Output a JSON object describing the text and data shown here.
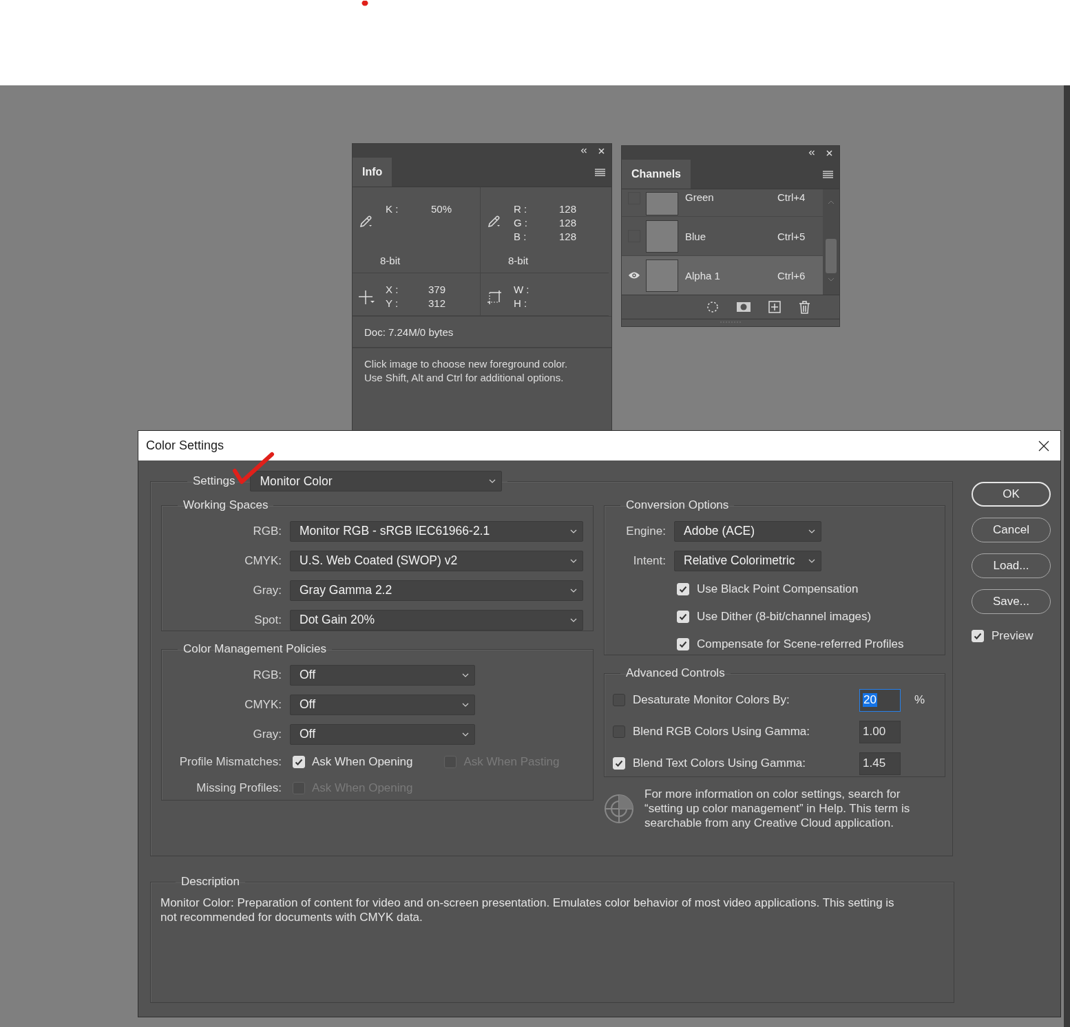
{
  "info_panel": {
    "tab": "Info",
    "color_readouts": [
      {
        "lines": [
          {
            "label": "K :",
            "value": "50%"
          }
        ],
        "bit_depth": "8-bit"
      },
      {
        "lines": [
          {
            "label": "R :",
            "value": "128"
          },
          {
            "label": "G :",
            "value": "128"
          },
          {
            "label": "B :",
            "value": "128"
          }
        ],
        "bit_depth": "8-bit"
      }
    ],
    "geometry_readouts": [
      {
        "kind": "point",
        "lines": [
          {
            "label": "X :",
            "value": "379"
          },
          {
            "label": "Y :",
            "value": "312"
          }
        ]
      },
      {
        "kind": "size",
        "lines": [
          {
            "label": "W :"
          },
          {
            "label": "H :"
          }
        ]
      }
    ],
    "doc": "Doc: 7.24M/0 bytes",
    "hint_lines": [
      "Click image to choose new foreground color.",
      "Use Shift, Alt and Ctrl for additional options."
    ]
  },
  "channels_panel": {
    "tab": "Channels",
    "channels": [
      {
        "name": "Green",
        "shortcut": "Ctrl+4",
        "visible": false,
        "selected": false
      },
      {
        "name": "Blue",
        "shortcut": "Ctrl+5",
        "visible": false,
        "selected": false
      },
      {
        "name": "Alpha 1",
        "shortcut": "Ctrl+6",
        "visible": true,
        "selected": true
      }
    ]
  },
  "dialog": {
    "title": "Color Settings",
    "settings": {
      "label": "Settings",
      "value": "Monitor Color"
    },
    "working_spaces": {
      "title": "Working Spaces",
      "rows": [
        {
          "label": "RGB:",
          "value": "Monitor RGB - sRGB IEC61966-2.1"
        },
        {
          "label": "CMYK:",
          "value": "U.S. Web Coated (SWOP) v2"
        },
        {
          "label": "Gray:",
          "value": "Gray Gamma 2.2"
        },
        {
          "label": "Spot:",
          "value": "Dot Gain 20%"
        }
      ]
    },
    "policies": {
      "title": "Color Management Policies",
      "rows": [
        {
          "label": "RGB:",
          "value": "Off"
        },
        {
          "label": "CMYK:",
          "value": "Off"
        },
        {
          "label": "Gray:",
          "value": "Off"
        }
      ],
      "checks": [
        {
          "label": "Profile Mismatches:",
          "options": [
            {
              "label": "Ask When Opening",
              "checked": true,
              "disabled": false
            },
            {
              "label": "Ask When Pasting",
              "checked": false,
              "disabled": true
            }
          ]
        },
        {
          "label": "Missing Profiles:",
          "options": [
            {
              "label": "Ask When Opening",
              "checked": false,
              "disabled": true
            }
          ]
        }
      ]
    },
    "conversion": {
      "title": "Conversion Options",
      "selects": [
        {
          "label": "Engine:",
          "value": "Adobe (ACE)"
        },
        {
          "label": "Intent:",
          "value": "Relative Colorimetric"
        }
      ],
      "options": [
        {
          "label": "Use Black Point Compensation",
          "checked": true
        },
        {
          "label": "Use Dither (8-bit/channel images)",
          "checked": true
        },
        {
          "label": "Compensate for Scene-referred Profiles",
          "checked": true
        }
      ]
    },
    "advanced": {
      "title": "Advanced Controls",
      "rows": [
        {
          "label": "Desaturate Monitor Colors By:",
          "checked": false,
          "value": "20",
          "value_selected": true,
          "unit": "%"
        },
        {
          "label": "Blend RGB Colors Using Gamma:",
          "checked": false,
          "value": "1.00",
          "value_selected": false
        },
        {
          "label": "Blend Text Colors Using Gamma:",
          "checked": true,
          "value": "1.45",
          "value_selected": false
        }
      ]
    },
    "help_text": "For more information on color settings, search for “setting up color management” in Help. This term is searchable from any Creative Cloud application.",
    "description": {
      "title": "Description",
      "text": "Monitor Color:  Preparation of content for video and on-screen presentation. Emulates color behavior of most video applications. This setting is not recommended for documents with CMYK data."
    },
    "buttons": [
      {
        "label": "OK",
        "default": true
      },
      {
        "label": "Cancel",
        "default": false
      },
      {
        "label": "Load...",
        "default": false
      },
      {
        "label": "Save...",
        "default": false
      }
    ],
    "preview": {
      "label": "Preview",
      "checked": true
    }
  }
}
